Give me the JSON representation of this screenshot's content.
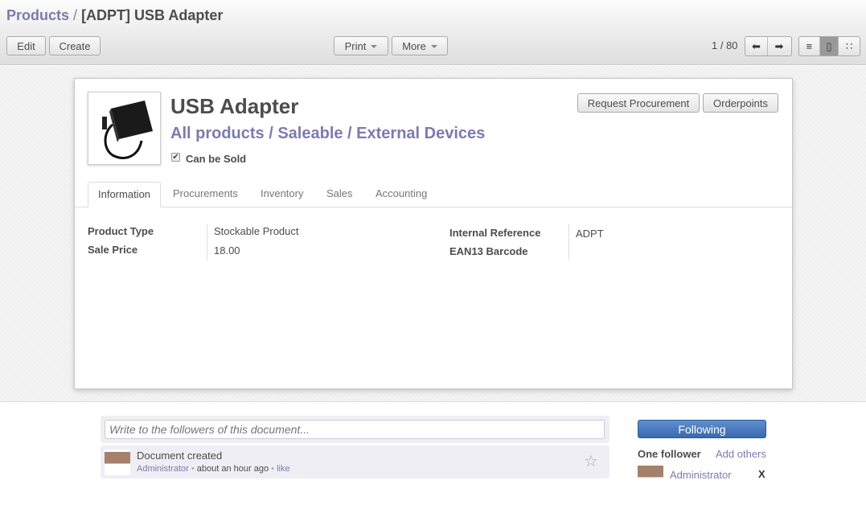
{
  "breadcrumb": {
    "parent": "Products",
    "separator": "/",
    "current": "[ADPT] USB Adapter"
  },
  "toolbar": {
    "edit": "Edit",
    "create": "Create",
    "print": "Print",
    "more": "More",
    "pager": "1 / 80",
    "prev_icon": "⬅",
    "next_icon": "➡",
    "list_icon": "≡",
    "form_icon": "▯",
    "kanban_icon": "∷"
  },
  "product": {
    "name": "USB Adapter",
    "category": "All products / Saleable / External Devices",
    "can_be_sold": "Can be Sold",
    "check": "✔"
  },
  "buttons": {
    "request_procurement": "Request Procurement",
    "orderpoints": "Orderpoints"
  },
  "tabs": [
    "Information",
    "Procurements",
    "Inventory",
    "Sales",
    "Accounting"
  ],
  "fields": {
    "product_type_label": "Product Type",
    "product_type": "Stockable Product",
    "sale_price_label": "Sale Price",
    "sale_price": "18.00",
    "internal_ref_label": "Internal Reference",
    "internal_ref": "ADPT",
    "ean13_label": "EAN13 Barcode",
    "ean13": ""
  },
  "chatter": {
    "placeholder": "Write to the followers of this document...",
    "message": {
      "title": "Document created",
      "author": "Administrator",
      "dot": "•",
      "time": "about an hour ago",
      "like": "like",
      "star": "☆"
    },
    "following": "Following",
    "followers_count": "One follower",
    "add_others": "Add others",
    "follower": "Administrator",
    "remove": "X"
  }
}
